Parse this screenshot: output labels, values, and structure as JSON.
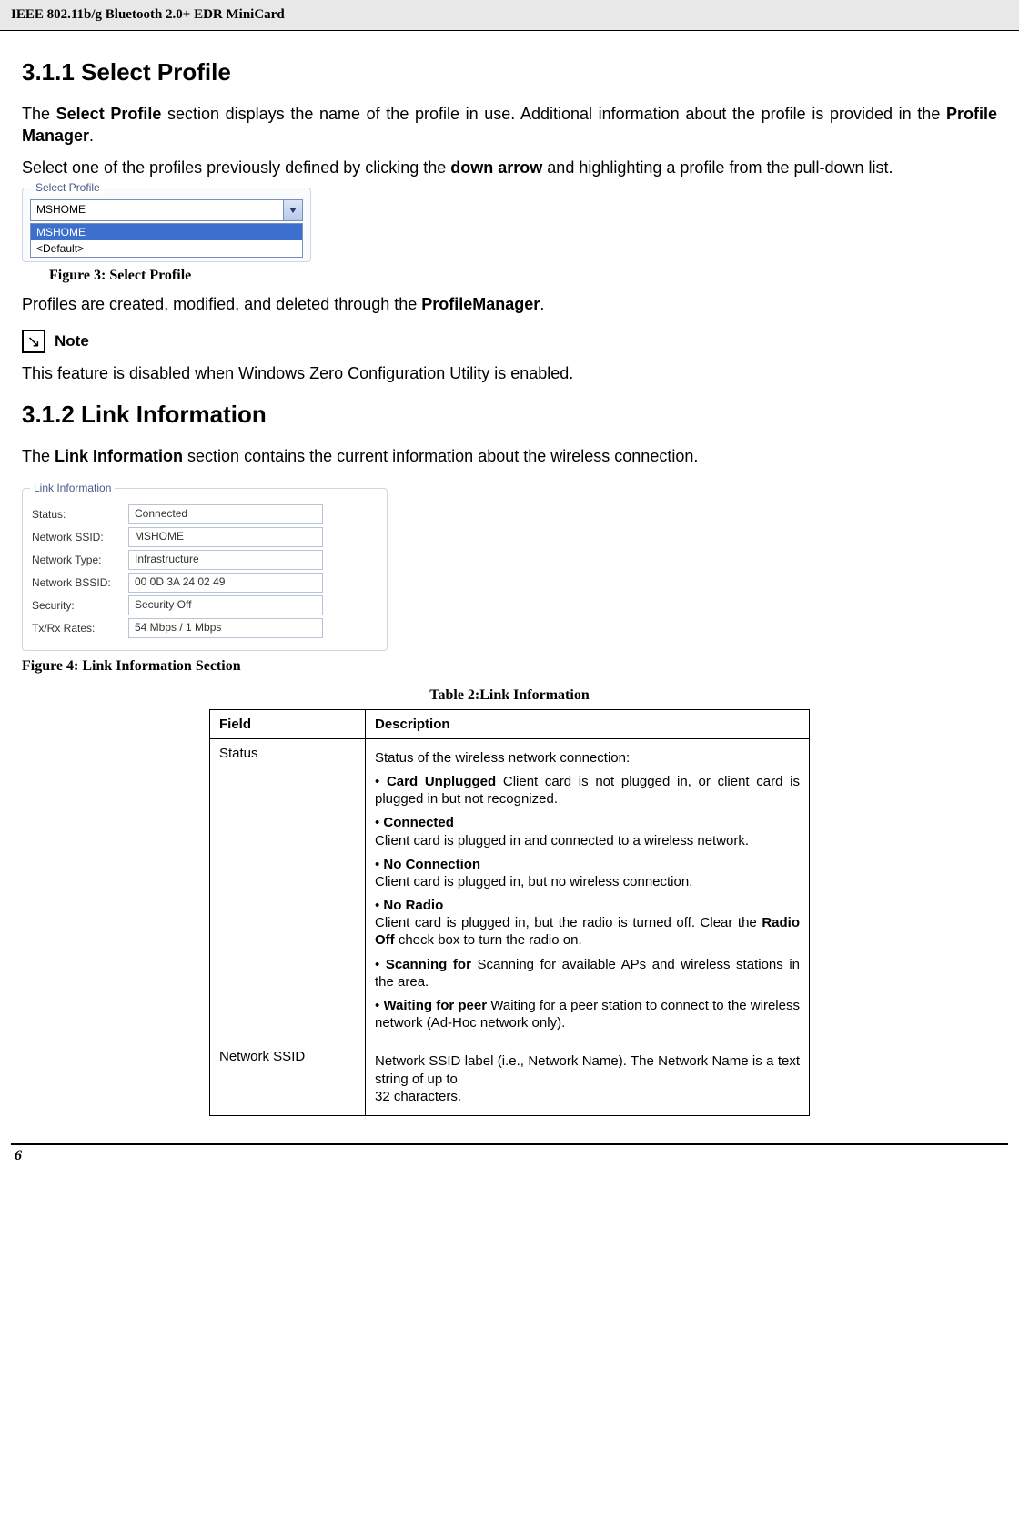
{
  "header": {
    "title": "IEEE 802.11b/g Bluetooth 2.0+ EDR MiniCard"
  },
  "section_311": {
    "heading": "3.1.1 Select Profile",
    "para1_pre": "The ",
    "para1_b1": "Select Profile",
    "para1_mid": " section displays the name of the profile in use. Additional information about the profile is provided in the ",
    "para1_b2": "Profile Manager",
    "para1_post": ".",
    "para2_pre": "Select one of the profiles previously defined by clicking the ",
    "para2_b": "down arrow",
    "para2_post": " and highlighting a profile from the pull-down list.",
    "fig_caption": "Figure 3: Select Profile",
    "para3_pre": "Profiles are created, modified, and deleted through the ",
    "para3_b": "ProfileManager",
    "para3_post": ".",
    "note_label": "Note",
    "note_text": "This feature is disabled when Windows Zero Configuration Utility is enabled."
  },
  "select_profile_widget": {
    "legend": "Select Profile",
    "selected": "MSHOME",
    "options": [
      "MSHOME",
      "<Default>"
    ]
  },
  "section_312": {
    "heading": "3.1.2 Link Information",
    "para_pre": "The ",
    "para_b": "Link Information",
    "para_post": " section contains the current information about the wireless connection.",
    "fig_caption": "Figure 4: Link Information Section",
    "table_caption": "Table 2:Link Information"
  },
  "link_info_widget": {
    "legend": "Link Information",
    "rows": [
      {
        "label": "Status:",
        "value": "Connected"
      },
      {
        "label": "Network SSID:",
        "value": "MSHOME"
      },
      {
        "label": "Network Type:",
        "value": "Infrastructure"
      },
      {
        "label": "Network BSSID:",
        "value": "00 0D 3A 24 02 49"
      },
      {
        "label": "Security:",
        "value": "Security Off"
      },
      {
        "label": "Tx/Rx Rates:",
        "value": "54 Mbps / 1 Mbps"
      }
    ]
  },
  "table": {
    "headers": [
      "Field",
      "Description"
    ],
    "rows": [
      {
        "field": "Status",
        "desc": {
          "intro": "Status of the wireless network connection:",
          "items": [
            {
              "b": "Card Unplugged",
              "t": " Client card is not plugged in, or client card is plugged in but not recognized."
            },
            {
              "b": "Connected",
              "t": "",
              "t2": "Client card is plugged in and connected to a wireless network."
            },
            {
              "b": "No Connection",
              "t": "",
              "t2": "Client card is plugged in, but no wireless connection."
            },
            {
              "b": "No Radio",
              "t": "",
              "t2_pre": "Client card is plugged in, but the radio is turned off. Clear the ",
              "t2_b": "Radio Off",
              "t2_post": " check box to turn the radio on."
            },
            {
              "b": "Scanning for",
              "t": " Scanning for available APs and wireless stations in the area."
            },
            {
              "b": "Waiting for peer",
              "t": " Waiting for a peer station to connect to the wireless network (Ad-Hoc network only)."
            }
          ]
        }
      },
      {
        "field": "Network SSID",
        "desc_plain": "Network SSID label (i.e., Network Name). The Network Name is a text string of up to\n32 characters."
      }
    ]
  },
  "footer": {
    "page": "6"
  }
}
